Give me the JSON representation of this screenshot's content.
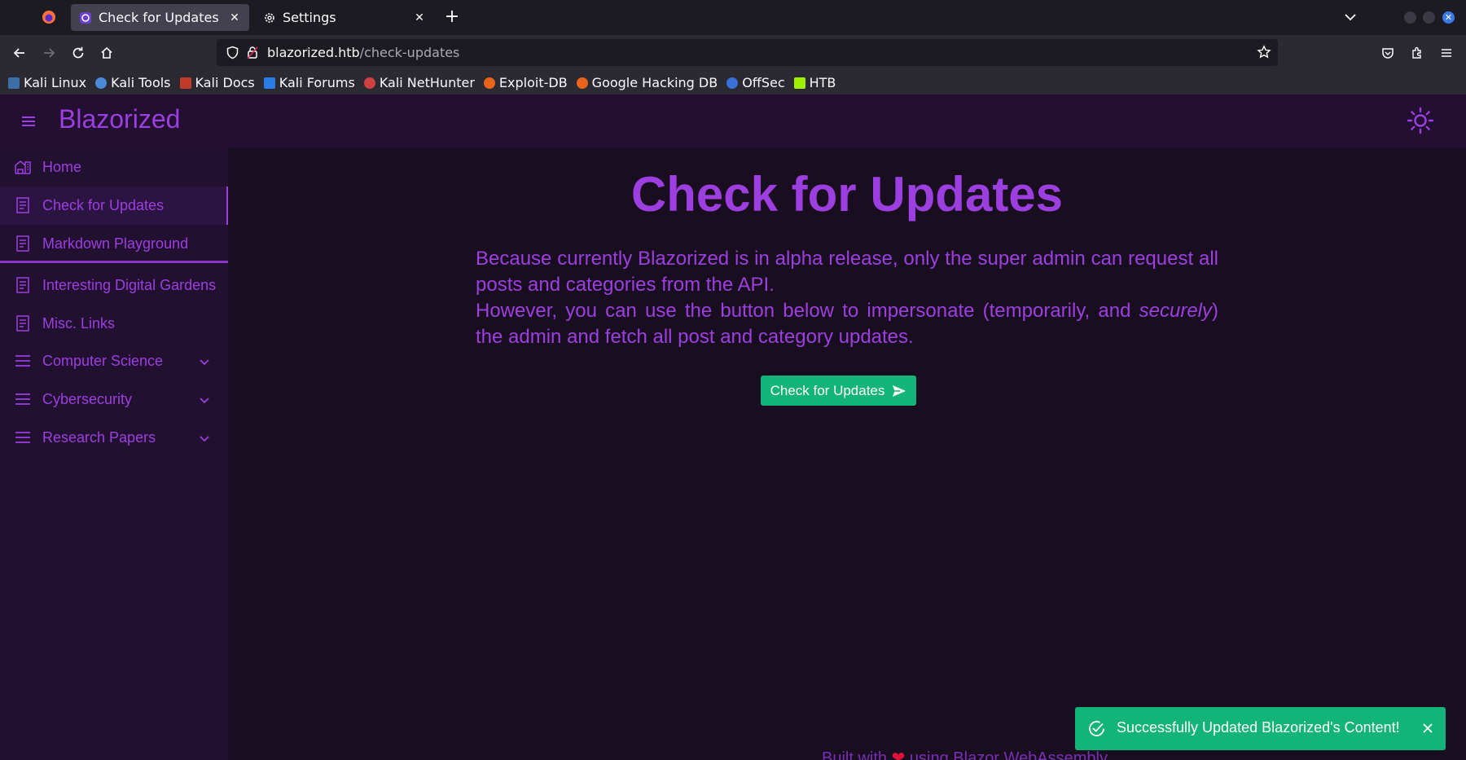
{
  "browser": {
    "tabs": [
      {
        "title": "Check for Updates",
        "icon": "blazorized-favicon-icon",
        "active": true
      },
      {
        "title": "Settings",
        "icon": "gear-icon",
        "active": false
      }
    ],
    "url": {
      "domain": "blazorized.htb",
      "path": "/check-updates"
    },
    "bookmarks": [
      {
        "label": "Kali Linux",
        "color": "#3b6ea5"
      },
      {
        "label": "Kali Tools",
        "color": "#4b8bd6"
      },
      {
        "label": "Kali Docs",
        "color": "#c0392b"
      },
      {
        "label": "Kali Forums",
        "color": "#2c7be5"
      },
      {
        "label": "Kali NetHunter",
        "color": "#d04040"
      },
      {
        "label": "Exploit-DB",
        "color": "#e8641c"
      },
      {
        "label": "Google Hacking DB",
        "color": "#e8641c"
      },
      {
        "label": "OffSec",
        "color": "#3a6fd8"
      },
      {
        "label": "HTB",
        "color": "#9fef00"
      }
    ]
  },
  "app": {
    "brand": "Blazorized",
    "accent_color": "#9d3ee0",
    "sidebar": {
      "items": [
        {
          "label": "Home",
          "icon": "home-icon",
          "selected": false,
          "expandable": false
        },
        {
          "label": "Check for Updates",
          "icon": "document-icon",
          "selected": true,
          "expandable": false
        },
        {
          "label": "Markdown Playground",
          "icon": "document-icon",
          "selected": false,
          "expandable": false
        },
        {
          "label": "Interesting Digital Gardens",
          "icon": "document-icon",
          "selected": false,
          "expandable": false
        },
        {
          "label": "Misc. Links",
          "icon": "document-icon",
          "selected": false,
          "expandable": false
        },
        {
          "label": "Computer Science",
          "icon": "list-icon",
          "selected": false,
          "expandable": true
        },
        {
          "label": "Cybersecurity",
          "icon": "list-icon",
          "selected": false,
          "expandable": true
        },
        {
          "label": "Research Papers",
          "icon": "list-icon",
          "selected": false,
          "expandable": true
        }
      ]
    },
    "main": {
      "heading": "Check for Updates",
      "paragraph_line1": "Because currently Blazorized is in alpha release, only the super admin can request all posts and categories from the API.",
      "paragraph_line2_before": "However, you can use the button below to impersonate (temporarily, and ",
      "paragraph_line2_emphasis": "securely",
      "paragraph_line2_after": ") the admin and fetch all post and category updates.",
      "button_label": "Check for Updates",
      "button_color": "#12b47a"
    },
    "footer": {
      "before": "Built with ",
      "heart": "❤",
      "after": " using Blazor WebAssembly"
    },
    "toast": {
      "message": "Successfully Updated Blazorized's Content!",
      "color": "#12b47a"
    }
  }
}
